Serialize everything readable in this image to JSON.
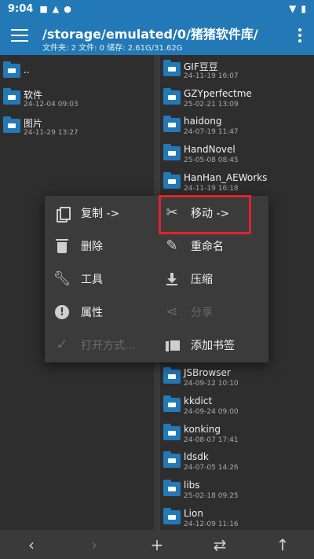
{
  "status_bar": {
    "time": "9:04",
    "icons": [
      "notification-b-icon",
      "notification-a-icon",
      "shield-icon",
      "wifi-icon",
      "battery-icon"
    ]
  },
  "toolbar": {
    "path": "/storage/emulated/0/猪猪软件库/",
    "summary": "文件夹: 2  文件: 0  储存: 2.61G/31.62G"
  },
  "left_pane": {
    "items": [
      {
        "name": "..",
        "date": ""
      },
      {
        "name": "软件",
        "date": "24-12-04 09:03"
      },
      {
        "name": "图片",
        "date": "24-11-29 13:27"
      }
    ]
  },
  "right_pane": {
    "items_top": [
      {
        "name": "GIF豆豆",
        "date": "24-11-19 16:07"
      },
      {
        "name": "GZYperfectme",
        "date": "25-02-21 13:09"
      },
      {
        "name": "haidong",
        "date": "24-07-19 11:47"
      },
      {
        "name": "HandNovel",
        "date": "25-05-08 08:45"
      },
      {
        "name": "HanHan_AEWorks",
        "date": "24-11-19 16:18"
      }
    ],
    "items_bottom": [
      {
        "name": "JSBrowser",
        "date": "24-09-12 10:10"
      },
      {
        "name": "kkdict",
        "date": "24-09-24 09:00"
      },
      {
        "name": "konking",
        "date": "24-08-07 17:41"
      },
      {
        "name": "ldsdk",
        "date": "24-07-05 14:26"
      },
      {
        "name": "libs",
        "date": "25-02-18 09:25"
      },
      {
        "name": "Lion",
        "date": "24-12-09 11:16"
      }
    ]
  },
  "context_menu": {
    "copy": "复制 ->",
    "move": "移动 ->",
    "delete": "删除",
    "rename": "重命名",
    "tools": "工具",
    "compress": "压缩",
    "properties": "属性",
    "share": "分享",
    "open_with": "打开方式...",
    "add_bookmark": "添加书签"
  },
  "nav_bar": {
    "back": "‹",
    "forward": "›",
    "add": "+",
    "swap": "⇄",
    "up": "↑"
  },
  "colors": {
    "accent": "#2379b6",
    "highlight": "#e0232a",
    "background": "#2b2b2b",
    "menu": "#3b3b3b"
  }
}
